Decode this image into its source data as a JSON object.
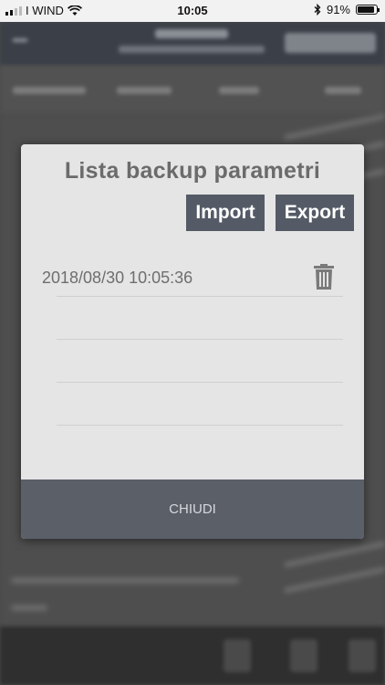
{
  "status_bar": {
    "carrier": "I WIND",
    "time": "10:05",
    "battery": "91%",
    "battery_level": 0.91,
    "signal_icon": "signal-bars-icon",
    "wifi_icon": "wifi-icon",
    "bluetooth_icon": "bluetooth-icon"
  },
  "dialog": {
    "title": "Lista backup parametri",
    "import_label": "Import",
    "export_label": "Export",
    "items": [
      {
        "label": "2018/08/30 10:05:36",
        "icon": "trash-icon"
      },
      {
        "label": ""
      },
      {
        "label": ""
      },
      {
        "label": ""
      }
    ],
    "close_label": "CHIUDI"
  },
  "colors": {
    "button_bg": "#545b66",
    "close_bar_bg": "#5a5f68",
    "dialog_bg": "#e5e5e5",
    "title_color": "#6b6b6b"
  }
}
